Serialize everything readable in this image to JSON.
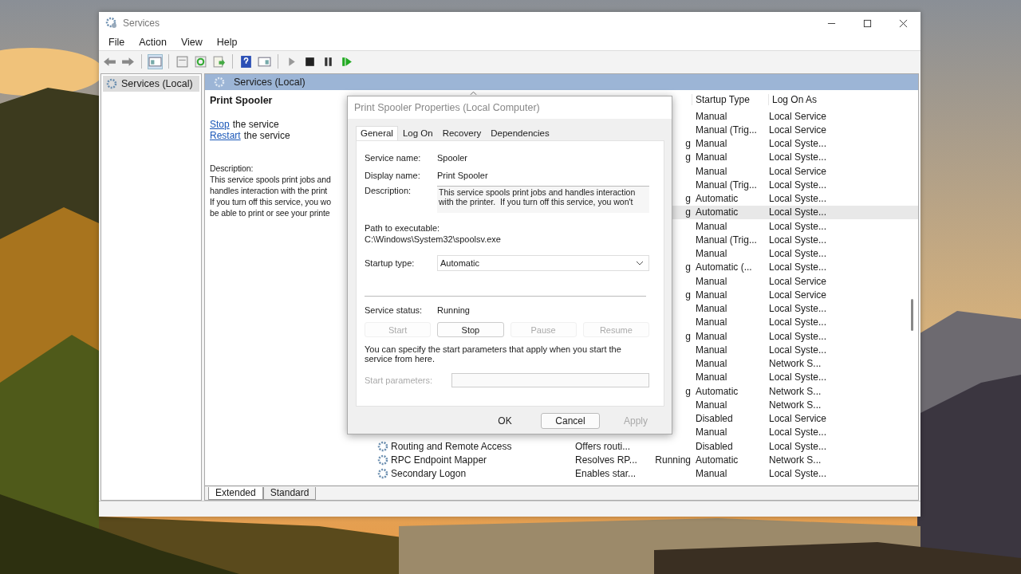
{
  "window": {
    "title": "Services"
  },
  "menu": [
    "File",
    "Action",
    "View",
    "Help"
  ],
  "tree": [
    {
      "label": "Services (Local)",
      "selected": true
    }
  ],
  "pane_header": "Services (Local)",
  "details": {
    "title": "Print Spooler",
    "actions": [
      {
        "link": "Stop",
        "rest": "the service"
      },
      {
        "link": "Restart",
        "rest": "the service"
      }
    ],
    "description_label": "Description:",
    "description_lines": [
      "This service spools print jobs and",
      "handles interaction with the print",
      "If you turn off this service, you wo",
      "be able to print or see your printe"
    ]
  },
  "columns": [
    {
      "label": "Startup Type"
    },
    {
      "label": "Log On As"
    }
  ],
  "rows": [
    {
      "startup": "Manual",
      "logon": "Local Service",
      "selected": false
    },
    {
      "startup": "Manual (Trig...",
      "logon": "Local Service",
      "selected": false
    },
    {
      "status": "g",
      "startup": "Manual",
      "logon": "Local Syste...",
      "selected": false
    },
    {
      "status": "g",
      "startup": "Manual",
      "logon": "Local Syste...",
      "selected": false
    },
    {
      "startup": "Manual",
      "logon": "Local Service",
      "selected": false
    },
    {
      "startup": "Manual (Trig...",
      "logon": "Local Syste...",
      "selected": false
    },
    {
      "status": "g",
      "startup": "Automatic",
      "logon": "Local Syste...",
      "selected": false
    },
    {
      "status": "g",
      "startup": "Automatic",
      "logon": "Local Syste...",
      "selected": true
    },
    {
      "startup": "Manual",
      "logon": "Local Syste...",
      "selected": false
    },
    {
      "startup": "Manual (Trig...",
      "logon": "Local Syste...",
      "selected": false
    },
    {
      "startup": "Manual",
      "logon": "Local Syste...",
      "selected": false
    },
    {
      "status": "g",
      "startup": "Automatic (...",
      "logon": "Local Syste...",
      "selected": false
    },
    {
      "startup": "Manual",
      "logon": "Local Service",
      "selected": false
    },
    {
      "status": "g",
      "startup": "Manual",
      "logon": "Local Service",
      "selected": false
    },
    {
      "startup": "Manual",
      "logon": "Local Syste...",
      "selected": false
    },
    {
      "startup": "Manual",
      "logon": "Local Syste...",
      "selected": false
    },
    {
      "status": "g",
      "startup": "Manual",
      "logon": "Local Syste...",
      "selected": false
    },
    {
      "startup": "Manual",
      "logon": "Local Syste...",
      "selected": false
    },
    {
      "startup": "Manual",
      "logon": "Network S...",
      "selected": false
    },
    {
      "startup": "Manual",
      "logon": "Local Syste...",
      "selected": false
    },
    {
      "status": "g",
      "startup": "Automatic",
      "logon": "Network S...",
      "selected": false
    },
    {
      "startup": "Manual",
      "logon": "Network S...",
      "selected": false
    },
    {
      "startup": "Disabled",
      "logon": "Local Service",
      "selected": false
    },
    {
      "startup": "Manual",
      "logon": "Local Syste...",
      "selected": false
    },
    {
      "name": "Routing and Remote Access",
      "description": "Offers routi...",
      "startup": "Disabled",
      "logon": "Local Syste...",
      "selected": false
    },
    {
      "name": "RPC Endpoint Mapper",
      "description": "Resolves RP...",
      "status": "Running",
      "startup": "Automatic",
      "logon": "Network S...",
      "selected": false
    },
    {
      "name": "Secondary Logon",
      "description": "Enables star...",
      "startup": "Manual",
      "logon": "Local Syste...",
      "selected": false
    }
  ],
  "view_tabs": [
    {
      "label": "Extended",
      "selected": true
    },
    {
      "label": "Standard",
      "selected": false
    }
  ],
  "dialog": {
    "title": "Print Spooler Properties (Local Computer)",
    "tabs": [
      {
        "label": "General",
        "selected": true
      },
      {
        "label": "Log On",
        "selected": false
      },
      {
        "label": "Recovery",
        "selected": false
      },
      {
        "label": "Dependencies",
        "selected": false
      }
    ],
    "fields": [
      {
        "label": "Service name:",
        "value": "Spooler"
      },
      {
        "label": "Display name:",
        "value": "Print Spooler"
      }
    ],
    "description": {
      "label": "Description:",
      "value": "This service spools print jobs and handles interaction with the printer.  If you turn off this service, you won't"
    },
    "path": {
      "label": "Path to executable:",
      "value": "C:\\Windows\\System32\\spoolsv.exe"
    },
    "startup_type": {
      "label": "Startup type:",
      "value": "Automatic"
    },
    "status": {
      "label": "Service status:",
      "value": "Running"
    },
    "control_buttons": [
      {
        "label": "Start",
        "disabled": true
      },
      {
        "label": "Stop",
        "disabled": false
      },
      {
        "label": "Pause",
        "disabled": true
      },
      {
        "label": "Resume",
        "disabled": true
      }
    ],
    "hint": "You can specify the start parameters that apply when you start the service from here.",
    "start_parameters": {
      "label": "Start parameters:",
      "disabled": true
    },
    "buttons": [
      {
        "label": "OK",
        "disabled": false,
        "focused": false
      },
      {
        "label": "Cancel",
        "disabled": false,
        "focused": true
      },
      {
        "label": "Apply",
        "disabled": true,
        "focused": false
      }
    ]
  }
}
